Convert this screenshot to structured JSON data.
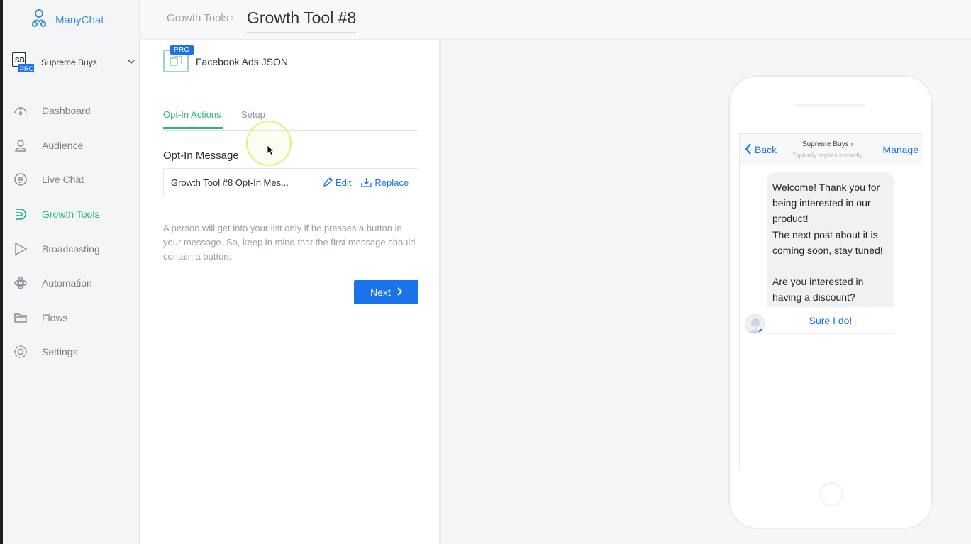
{
  "app": {
    "name": "ManyChat"
  },
  "account": {
    "name": "Supreme Buys",
    "badge": "PRO"
  },
  "nav": [
    {
      "id": "dashboard",
      "label": "Dashboard",
      "icon": "dashboard-icon"
    },
    {
      "id": "audience",
      "label": "Audience",
      "icon": "user-icon"
    },
    {
      "id": "live-chat",
      "label": "Live Chat",
      "icon": "chat-icon"
    },
    {
      "id": "growth-tools",
      "label": "Growth Tools",
      "icon": "growth-icon",
      "active": true
    },
    {
      "id": "broadcasting",
      "label": "Broadcasting",
      "icon": "play-icon"
    },
    {
      "id": "automation",
      "label": "Automation",
      "icon": "automation-icon"
    },
    {
      "id": "flows",
      "label": "Flows",
      "icon": "folder-icon"
    },
    {
      "id": "settings",
      "label": "Settings",
      "icon": "gear-icon"
    }
  ],
  "header": {
    "breadcrumb": "Growth Tools",
    "separator": "›",
    "title": "Growth Tool #8"
  },
  "tool": {
    "badge": "PRO",
    "name": "Facebook Ads JSON"
  },
  "tabs": [
    {
      "label": "Opt-In Actions",
      "active": true
    },
    {
      "label": "Setup",
      "active": false
    }
  ],
  "optin": {
    "section_title": "Opt-In Message",
    "message_name": "Growth Tool #8 Opt-In Mes...",
    "edit_label": "Edit",
    "replace_label": "Replace",
    "hint": "A person will get into your list only if he presses a button in your message. So, keep in mind that the first message should contain a button.",
    "next_label": "Next"
  },
  "preview": {
    "back_label": "Back",
    "page_name": "Supreme Buys ›",
    "page_sub": "Typically replies instantly",
    "manage_label": "Manage",
    "message": "Welcome! Thank you for being interested in our product!\nThe next post about it is coming soon, stay tuned!\n\nAre you interested in having a discount?",
    "quick_reply": "Sure I do!"
  },
  "colors": {
    "accent_green": "#2fb67c",
    "accent_blue": "#1a73e8",
    "brand_blue": "#3d8fd6"
  }
}
